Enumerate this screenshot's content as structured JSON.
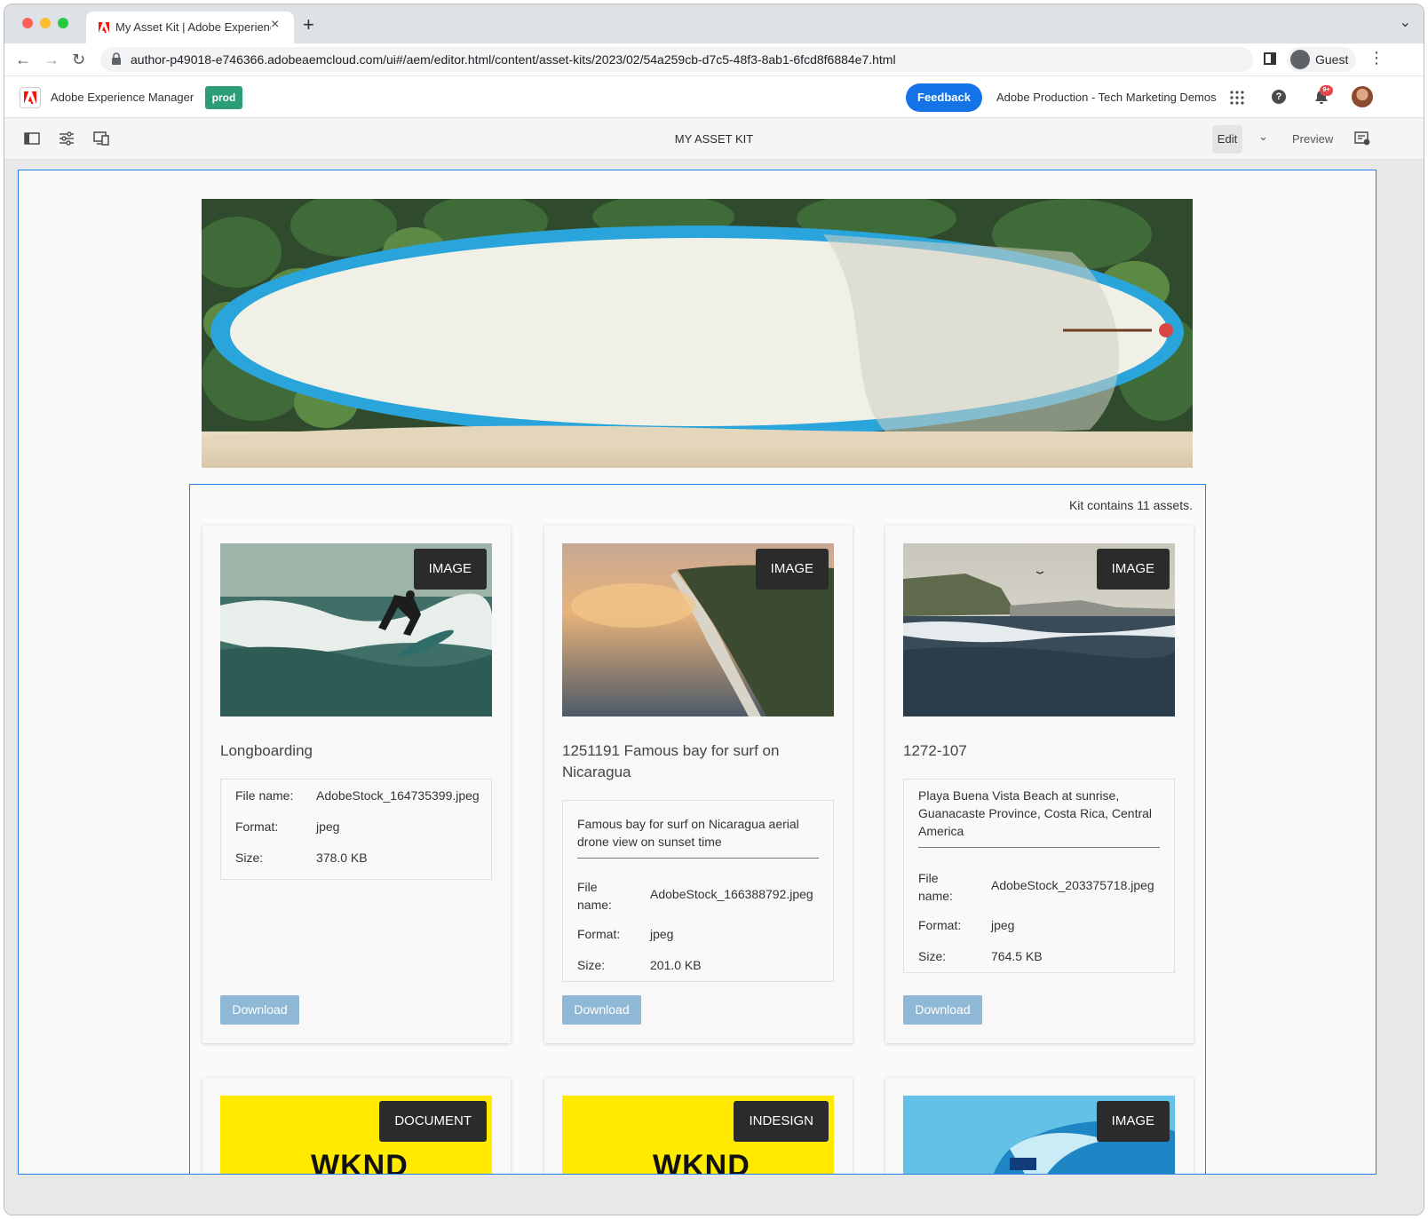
{
  "browser": {
    "tab_title": "My Asset Kit | Adobe Experience Manager",
    "url": "author-p49018-e746366.adobeaemcloud.com/ui#/aem/editor.html/content/asset-kits/2023/02/54a259cb-d7c5-48f3-8ab1-6fcd8f6884e7.html",
    "profile_label": "Guest"
  },
  "aem": {
    "product_name": "Adobe Experience Manager",
    "env_badge": "prod",
    "feedback_label": "Feedback",
    "org_name": "Adobe Production - Tech Marketing Demos",
    "notification_badge": "9+"
  },
  "editor": {
    "page_title": "MY ASSET KIT",
    "edit_label": "Edit",
    "preview_label": "Preview"
  },
  "kit": {
    "count_text": "Kit contains 11 assets.",
    "labels": {
      "file_name": "File name:",
      "file_name_wrapped": "File name:",
      "format": "Format:",
      "size": "Size:",
      "download": "Download"
    },
    "assets": [
      {
        "type": "IMAGE",
        "title": "Longboarding",
        "description": "",
        "file_name": "AdobeStock_164735399.jpeg",
        "format": "jpeg",
        "size": "378.0 KB"
      },
      {
        "type": "IMAGE",
        "title": "1251191 Famous bay for surf on Nicaragua",
        "description": "Famous bay for surf on Nicaragua aerial drone view on sunset time",
        "file_name": "AdobeStock_166388792.jpeg",
        "format": "jpeg",
        "size": "201.0 KB"
      },
      {
        "type": "IMAGE",
        "title": "1272-107",
        "description": "Playa Buena Vista Beach at sunrise, Guanacaste Province, Costa Rica, Central America",
        "file_name": "AdobeStock_203375718.jpeg",
        "format": "jpeg",
        "size": "764.5 KB"
      },
      {
        "type": "DOCUMENT",
        "thumb_text": "WKND"
      },
      {
        "type": "INDESIGN",
        "thumb_text": "WKND"
      },
      {
        "type": "IMAGE"
      }
    ]
  },
  "colors": {
    "accent": "#1473e6",
    "selection": "#2680eb",
    "prod": "#2d9d78",
    "download": "#8fb8d6",
    "tag": "#2b2b2b",
    "wknd_yellow": "#ffea00"
  }
}
